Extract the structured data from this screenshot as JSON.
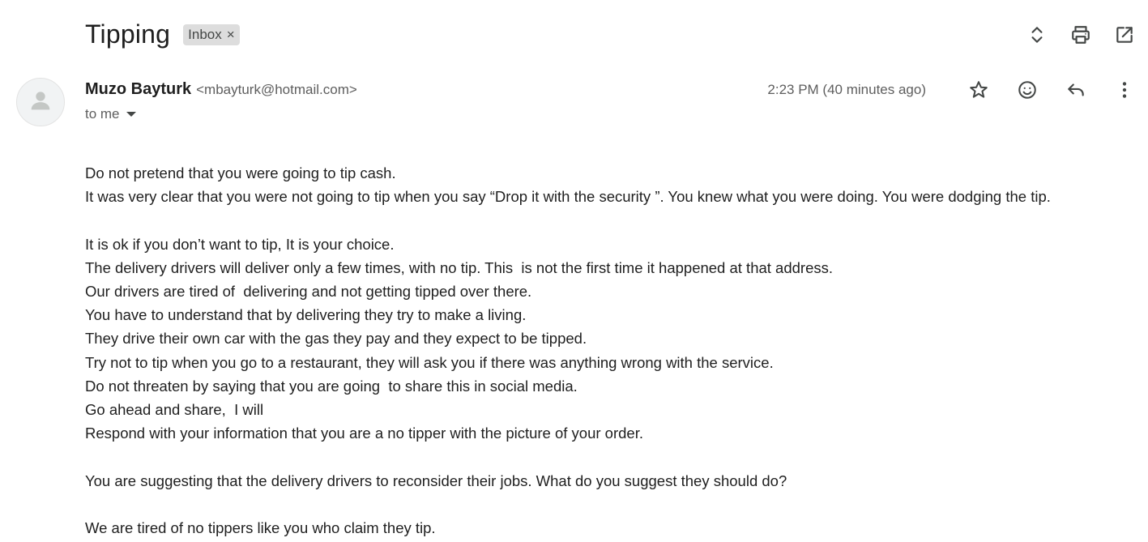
{
  "header": {
    "subject": "Tipping",
    "label": "Inbox",
    "label_close": "×"
  },
  "sender": {
    "name": "Muzo Bayturk",
    "email": "<mbayturk@hotmail.com>",
    "recipient": "to me",
    "timestamp": "2:23 PM (40 minutes ago)"
  },
  "icons": {
    "top": [
      "expand-collapse-icon",
      "print-icon",
      "open-in-new-window-icon"
    ],
    "message": [
      "star-icon",
      "emoji-reaction-icon",
      "reply-icon",
      "more-vert-icon"
    ],
    "avatar": "person-icon"
  },
  "body": {
    "lines": [
      "Do not pretend that you were going to tip cash.",
      "It was very clear that you were not going to tip when you say “Drop it with the security ”. You knew what you were doing. You were dodging the tip.",
      "",
      "It is ok if you don’t want to tip, It is your choice.",
      "The delivery drivers will deliver only a few times, with no tip. This  is not the first time it happened at that address.",
      "Our drivers are tired of  delivering and not getting tipped over there.",
      "You have to understand that by delivering they try to make a living.",
      "They drive their own car with the gas they pay and they expect to be tipped.",
      "Try not to tip when you go to a restaurant, they will ask you if there was anything wrong with the service.",
      "Do not threaten by saying that you are going  to share this in social media.",
      "Go ahead and share,  I will",
      "Respond with your information that you are a no tipper with the picture of your order.",
      "",
      "You are suggesting that the delivery drivers to reconsider their jobs. What do you suggest they should do?",
      "",
      "We are tired of no tippers like you who claim they tip."
    ]
  }
}
